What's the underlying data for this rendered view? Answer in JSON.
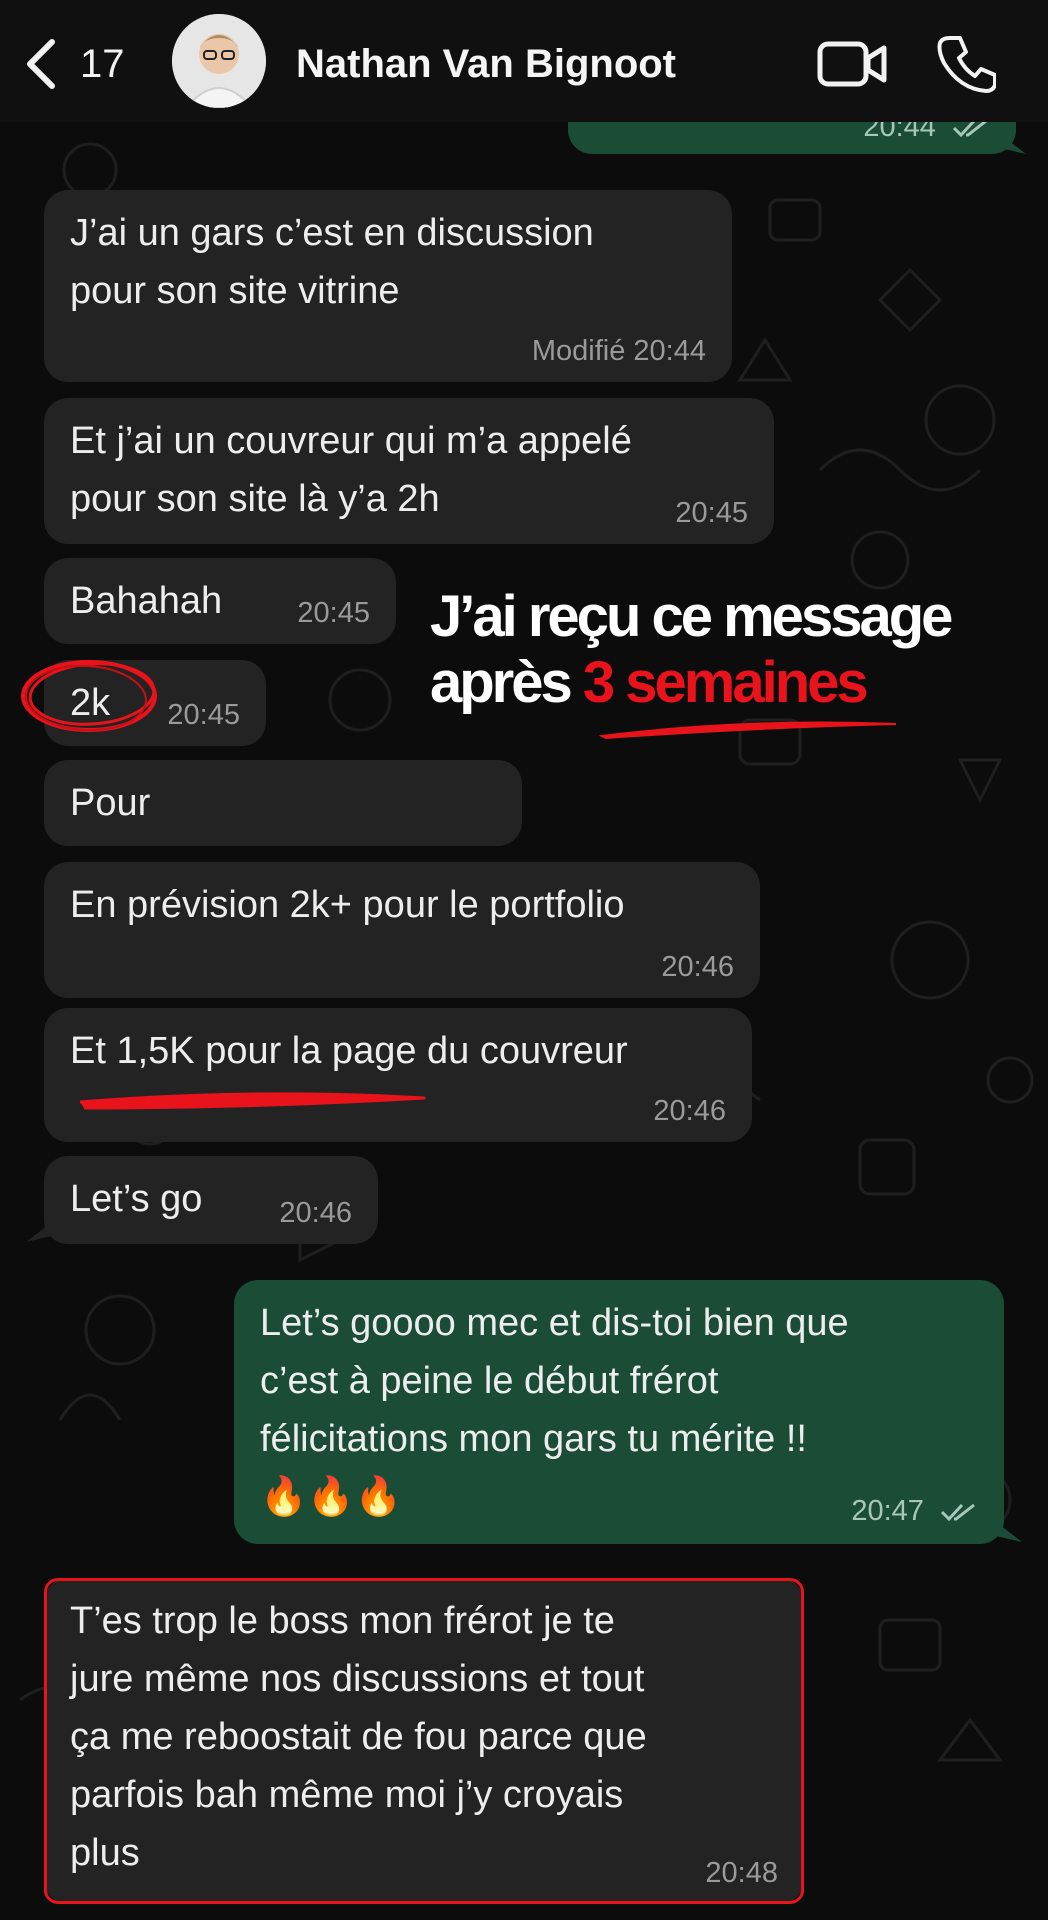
{
  "header": {
    "back_count": "17",
    "contact_name": "Nathan Van Bignoot"
  },
  "top_partial": {
    "time": "20:44"
  },
  "messages": [
    {
      "text": "J’ai un gars c’est en discussion\npour son site vitrine",
      "edited": "Modifié",
      "time": "20:44"
    },
    {
      "text": "Et j’ai un couvreur qui m’a appelé\npour son site là y’a 2h",
      "time": "20:45"
    },
    {
      "text": "Bahahah",
      "time": "20:45"
    },
    {
      "text": "2k",
      "time": "20:45"
    },
    {
      "text": "Pour"
    },
    {
      "text": "En prévision 2k+ pour le portfolio",
      "time": "20:46"
    },
    {
      "text": "Et 1,5K pour la page du couvreur",
      "time": "20:46"
    },
    {
      "text": "Let’s go",
      "time": "20:46"
    },
    {
      "text": "Let’s goooo mec et dis-toi bien que\nc’est à peine le début frérot\nfélicitations mon gars tu mérite !!\n🔥🔥🔥",
      "time": "20:47",
      "outgoing": true
    },
    {
      "text": "T’es trop le boss mon frérot je te\njure même nos discussions et tout\nça me reboostait de fou parce que\nparfois bah même moi j’y croyais\nplus",
      "time": "20:48"
    }
  ],
  "overlay": {
    "line1": "J’ai reçu ce message",
    "line2_prefix": "après ",
    "line2_highlight": "3 semaines"
  },
  "colors": {
    "incoming_bubble": "#232323",
    "outgoing_bubble": "#1a4c36",
    "annotation_red": "#e8131b"
  },
  "icons": [
    "chevron-left-icon",
    "video-camera-icon",
    "phone-icon",
    "double-check-icon"
  ]
}
